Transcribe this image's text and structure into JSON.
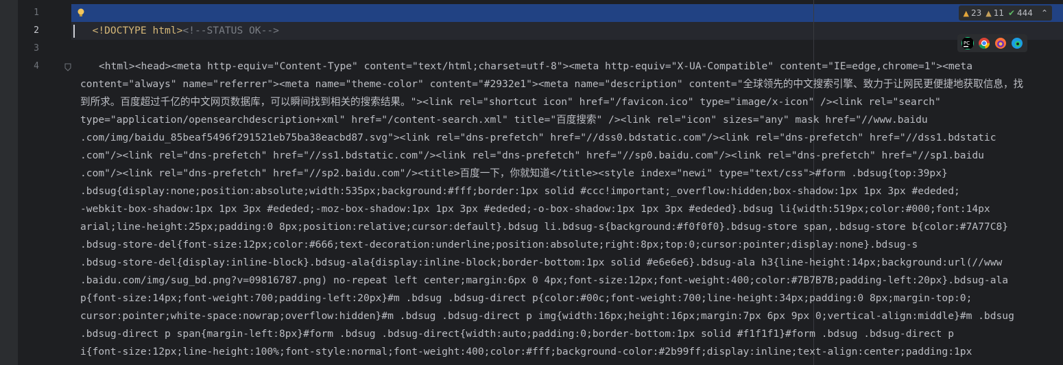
{
  "editor": {
    "line_numbers": [
      "1",
      "2",
      "3",
      "4"
    ],
    "line1": {
      "part1": "<!DOCTYPE html>",
      "comment": "<!--STATUS OK-->"
    },
    "line4": [
      "<html><head><meta http-equiv=\"Content-Type\" content=\"text/html;charset=utf-8\"><meta http-equiv=\"X-UA-Compatible\" content=\"IE=edge,chrome=1\"><meta",
      "content=\"always\" name=\"referrer\"><meta name=\"theme-color\" content=\"#2932e1\"><meta name=\"description\" content=\"全球领先的中文搜索引擎、致力于让网民更便捷地获取信息，找",
      "到所求。百度超过千亿的中文网页数据库，可以瞬间找到相关的搜索结果。\"><link rel=\"shortcut icon\" href=\"/favicon.ico\" type=\"image/x-icon\" /><link rel=\"search\"",
      "type=\"application/opensearchdescription+xml\" href=\"/content-search.xml\" title=\"百度搜索\" /><link rel=\"icon\" sizes=\"any\" mask href=\"//www.baidu",
      ".com/img/baidu_85beaf5496f291521eb75ba38eacbd87.svg\"><link rel=\"dns-prefetch\" href=\"//dss0.bdstatic.com\"/><link rel=\"dns-prefetch\" href=\"//dss1.bdstatic",
      ".com\"/><link rel=\"dns-prefetch\" href=\"//ss1.bdstatic.com\"/><link rel=\"dns-prefetch\" href=\"//sp0.baidu.com\"/><link rel=\"dns-prefetch\" href=\"//sp1.baidu",
      ".com\"/><link rel=\"dns-prefetch\" href=\"//sp2.baidu.com\"/><title>百度一下，你就知道</title><style index=\"newi\" type=\"text/css\">#form .bdsug{top:39px}",
      ".bdsug{display:none;position:absolute;width:535px;background:#fff;border:1px solid #ccc!important;_overflow:hidden;box-shadow:1px 1px 3px #ededed;",
      "-webkit-box-shadow:1px 1px 3px #ededed;-moz-box-shadow:1px 1px 3px #ededed;-o-box-shadow:1px 1px 3px #ededed}.bdsug li{width:519px;color:#000;font:14px",
      "arial;line-height:25px;padding:0 8px;position:relative;cursor:default}.bdsug li.bdsug-s{background:#f0f0f0}.bdsug-store span,.bdsug-store b{color:#7A77C8}",
      ".bdsug-store-del{font-size:12px;color:#666;text-decoration:underline;position:absolute;right:8px;top:0;cursor:pointer;display:none}.bdsug-s",
      ".bdsug-store-del{display:inline-block}.bdsug-ala{display:inline-block;border-bottom:1px solid #e6e6e6}.bdsug-ala h3{line-height:14px;background:url(//www",
      ".baidu.com/img/sug_bd.png?v=09816787.png) no-repeat left center;margin:6px 0 4px;font-size:12px;font-weight:400;color:#7B7B7B;padding-left:20px}.bdsug-ala",
      "p{font-size:14px;font-weight:700;padding-left:20px}#m .bdsug .bdsug-direct p{color:#00c;font-weight:700;line-height:34px;padding:0 8px;margin-top:0;",
      "cursor:pointer;white-space:nowrap;overflow:hidden}#m .bdsug .bdsug-direct p img{width:16px;height:16px;margin:7px 6px 9px 0;vertical-align:middle}#m .bdsug",
      ".bdsug-direct p span{margin-left:8px}#form .bdsug .bdsug-direct{width:auto;padding:0;border-bottom:1px solid #f1f1f1}#form .bdsug .bdsug-direct p",
      "i{font-size:12px;line-height:100%;font-style:normal;font-weight:400;color:#fff;background-color:#2b99ff;display:inline;text-align:center;padding:1px"
    ]
  },
  "inspections": {
    "warnings": "23",
    "weak_warnings": "11",
    "ok": "444"
  },
  "colors": {
    "background": "#1e1f22",
    "selection": "#214283",
    "tag": "#d5b778",
    "string": "#6aab73",
    "number": "#2aacb8"
  },
  "icons": [
    "lightbulb-icon",
    "fold-icon",
    "warning-icon",
    "weak-warning-icon",
    "check-icon",
    "chevron-up-icon",
    "pycharm-icon",
    "chrome-icon",
    "firefox-icon",
    "edge-icon"
  ]
}
